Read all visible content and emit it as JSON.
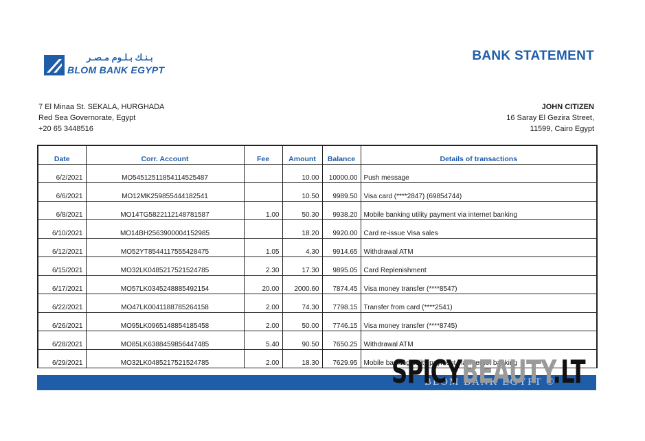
{
  "bank": {
    "logo_arabic": "بـنـك بـلـوم مـصـر",
    "logo_text": "BLOM BANK EGYPT",
    "address": [
      "7 El Minaa St. SEKALA, HURGHADA",
      "Red Sea Governorate, Egypt",
      "+20 65 3448516"
    ]
  },
  "document": {
    "title": "BANK STATEMENT"
  },
  "customer": {
    "name": "JOHN CITIZEN",
    "address": [
      "16 Saray El Gezira Street,",
      "11599, Cairo Egypt"
    ]
  },
  "table": {
    "headers": [
      "Date",
      "Corr. Account",
      "Fee",
      "Amount",
      "Balance",
      "Details of transactions"
    ],
    "rows": [
      [
        "6/2/2021",
        "MO54512511854114525487",
        "",
        "10.00",
        "10000.00",
        "Push message"
      ],
      [
        "6/6/2021",
        "MO12MK259855444182541",
        "",
        "10.50",
        "9989.50",
        "Visa  card (****2847) (69854744)"
      ],
      [
        "6/8/2021",
        "MO14TG5822112148781587",
        "1.00",
        "50.30",
        "9938.20",
        "Mobile banking utility payment via internet banking"
      ],
      [
        "6/10/2021",
        "MO14BH2563900004152985",
        "",
        "18.20",
        "9920.00",
        "Card re-issue Visa sales"
      ],
      [
        "6/12/2021",
        "MO52YT8544117555428475",
        "1.05",
        "4.30",
        "9914.65",
        "Withdrawal ATM"
      ],
      [
        "6/15/2021",
        "MO32LK0485217521524785",
        "2.30",
        "17.30",
        "9895.05",
        "Card Replenishment"
      ],
      [
        "6/17/2021",
        "MO57LK0345248885492154",
        "20.00",
        "2000.60",
        "7874.45",
        "Visa  money transfer (****8547)"
      ],
      [
        "6/22/2021",
        "MO47LK0041188785264158",
        "2.00",
        "74.30",
        "7798.15",
        "Transfer from card (****2541)"
      ],
      [
        "6/26/2021",
        "MO95LK0965148854185458",
        "2.00",
        "50.00",
        "7746.15",
        "Visa money transfer (****8745)"
      ],
      [
        "6/28/2021",
        "MO85LK6388459856447485",
        "5.40",
        "90.50",
        "7650.25",
        "Withdrawal ATM"
      ],
      [
        "6/29/2021",
        "MO32LK0485217521524785",
        "2.00",
        "18.30",
        "7629.95",
        "Mobile banking utility payment via internet banking"
      ]
    ]
  },
  "footer": {
    "watermark": "BLOM BANK EGYPT ©"
  },
  "overlay": {
    "part1": "SPICY",
    "part2": "BEAUTY",
    "part3": ".LT"
  },
  "colors": {
    "brand": "#1f5da8"
  }
}
